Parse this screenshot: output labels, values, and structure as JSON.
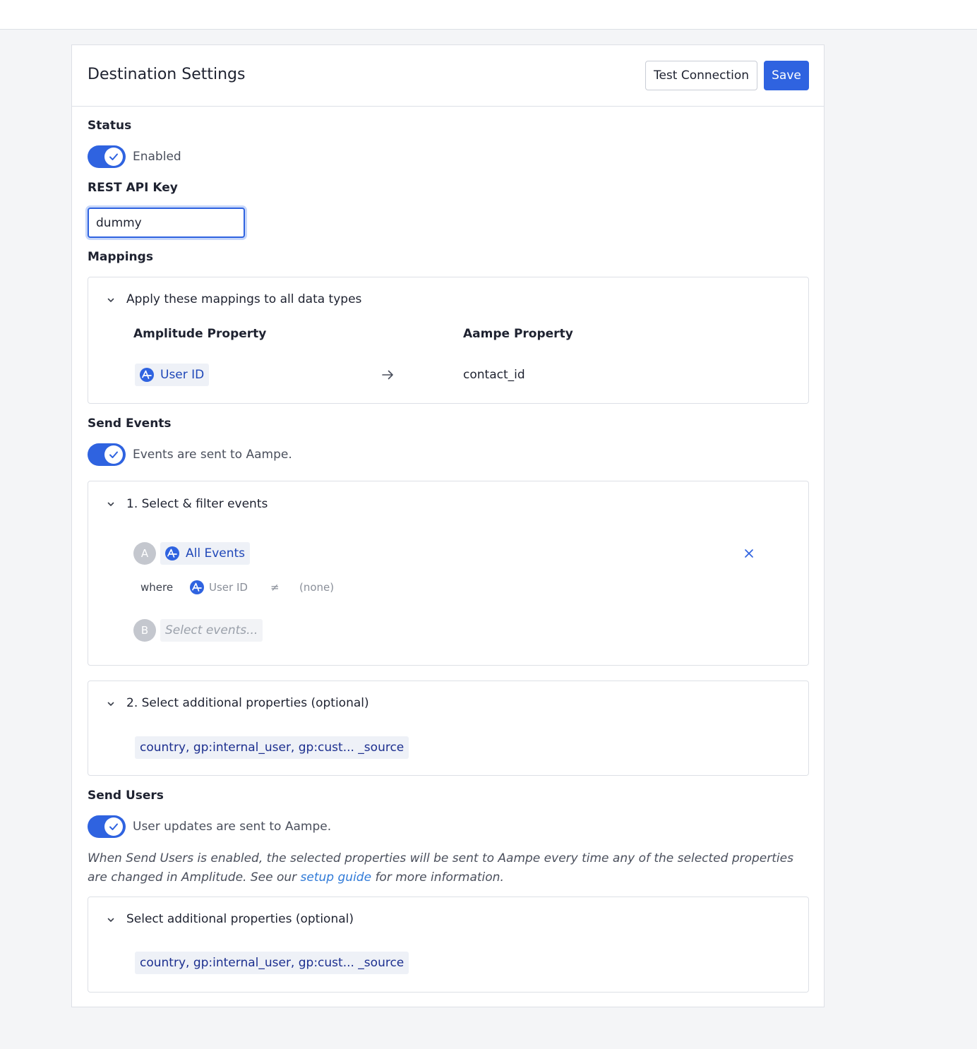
{
  "header": {
    "title": "Destination Settings",
    "test_connection_label": "Test Connection",
    "save_label": "Save"
  },
  "status": {
    "label": "Status",
    "enabled": true,
    "toggle_text": "Enabled"
  },
  "api_key": {
    "label": "REST API Key",
    "value": "dummy"
  },
  "mappings": {
    "label": "Mappings",
    "section_title": "Apply these mappings to all data types",
    "left_header": "Amplitude Property",
    "right_header": "Aampe Property",
    "rows": [
      {
        "source": "User ID",
        "icon": "amplitude-logo-icon",
        "arrow_icon": "arrow-right-icon",
        "target": "contact_id"
      }
    ]
  },
  "send_events": {
    "label": "Send Events",
    "enabled": true,
    "toggle_text": "Events are sent to Aampe.",
    "select_section": {
      "title": "1. Select & filter events",
      "rows": [
        {
          "letter": "A",
          "event": "All Events",
          "remove_icon": "close-icon"
        },
        {
          "letter": "B",
          "placeholder": "Select events..."
        }
      ],
      "filter": {
        "where_label": "where",
        "property": "User ID",
        "operator": "≠",
        "value": "(none)"
      }
    },
    "properties_section": {
      "title": "2. Select additional properties (optional)",
      "value": "country, gp:internal_user, gp:cust...  _source"
    }
  },
  "send_users": {
    "label": "Send Users",
    "enabled": true,
    "toggle_text": "User updates are sent to Aampe.",
    "help_before": "When Send Users is enabled, the selected properties will be sent to Aampe every time any of the selected properties are changed in Amplitude. See our ",
    "help_link": "setup guide",
    "help_after": " for more information.",
    "properties_section": {
      "title": "Select additional properties (optional)",
      "value": "country, gp:internal_user, gp:cust...  _source"
    }
  },
  "colors": {
    "primary": "#2f63e0",
    "page_bg": "#f4f5f7",
    "border": "#dde0e6",
    "chip_bg": "#eef1f7",
    "link": "#2f7ad8"
  }
}
